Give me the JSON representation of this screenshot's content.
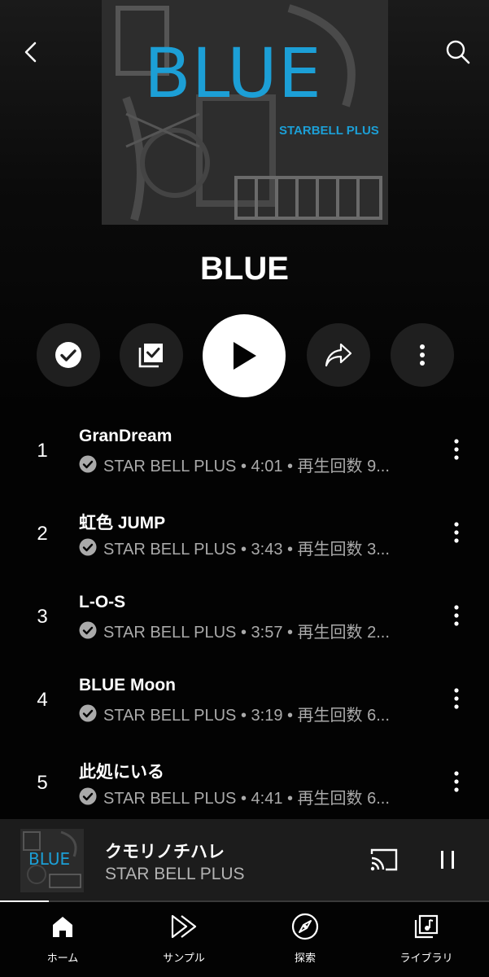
{
  "album": {
    "title": "BLUE",
    "art_title": "BLUE",
    "art_brand": "STARBELL PLUS"
  },
  "tracks": [
    {
      "num": "1",
      "title": "GranDream",
      "meta": "STAR BELL PLUS • 4:01 • 再生回数 9..."
    },
    {
      "num": "2",
      "title": "虹色 JUMP",
      "meta": "STAR BELL PLUS • 3:43 • 再生回数 3..."
    },
    {
      "num": "3",
      "title": "L-O-S",
      "meta": "STAR BELL PLUS • 3:57 • 再生回数 2..."
    },
    {
      "num": "4",
      "title": "BLUE Moon",
      "meta": "STAR BELL PLUS • 3:19 • 再生回数 6..."
    },
    {
      "num": "5",
      "title": "此処にいる",
      "meta": "STAR BELL PLUS • 4:41 • 再生回数 6..."
    }
  ],
  "now_playing": {
    "title": "クモリノチハレ",
    "artist": "STAR BELL PLUS",
    "art_title": "BLUE",
    "progress": 0.1
  },
  "nav": {
    "home": "ホーム",
    "samples": "サンプル",
    "explore": "探索",
    "library": "ライブラリ"
  },
  "colors": {
    "accent_blue": "#1c9fd6",
    "background": "#030303",
    "meta_text": "#aaaaaa"
  }
}
